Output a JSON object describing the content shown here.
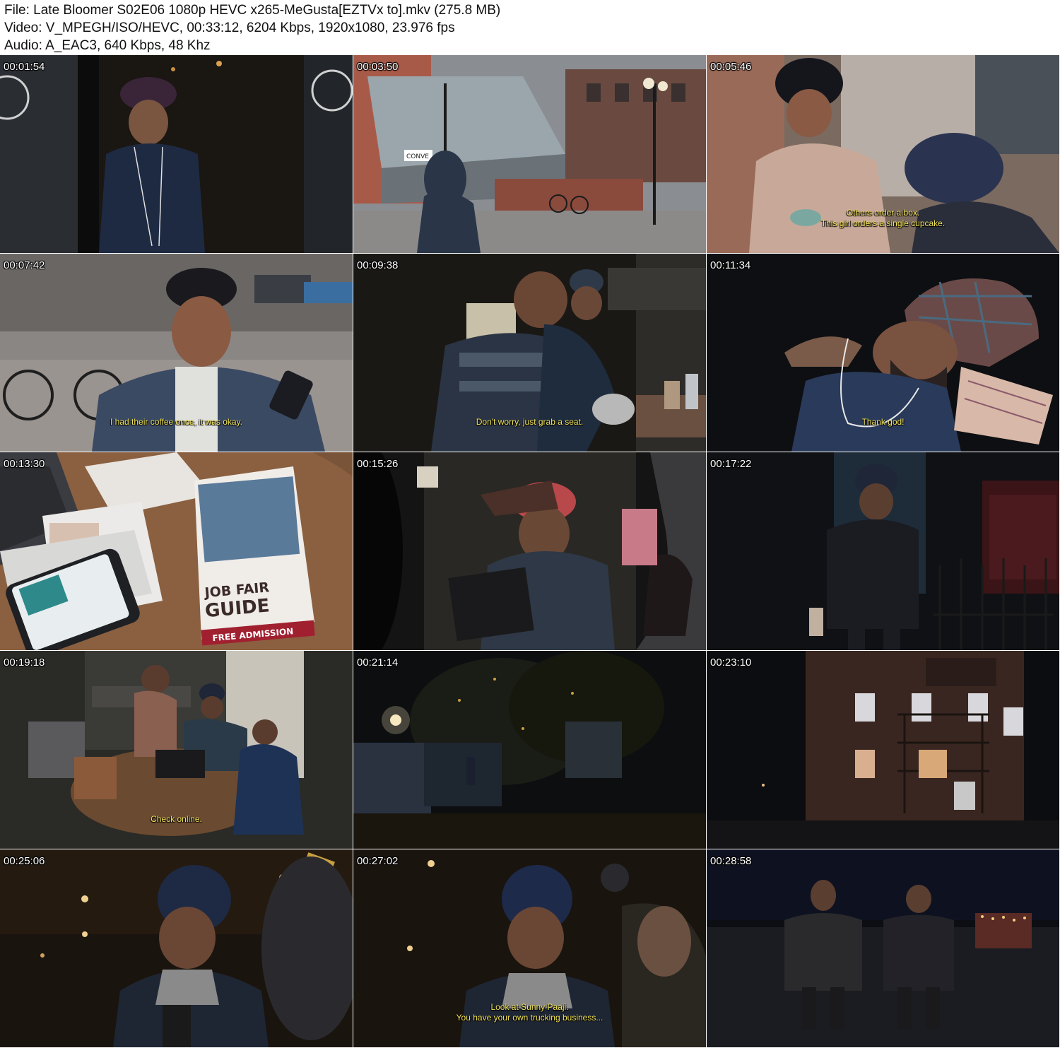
{
  "header": {
    "file_line": "File: Late Bloomer S02E06 1080p HEVC x265-MeGusta[EZTVx to].mkv (275.8 MB)",
    "video_line": "Video: V_MPEGH/ISO/HEVC, 00:33:12, 6204 Kbps, 1920x1080, 23.976 fps",
    "audio_line": "Audio: A_EAC3, 640 Kbps, 48 Khz"
  },
  "frames": [
    {
      "time": "00:01:54",
      "subtitle": []
    },
    {
      "time": "00:03:50",
      "subtitle": [],
      "sign_text": "CONVE"
    },
    {
      "time": "00:05:46",
      "subtitle": [
        "Others order a box.",
        "This girl orders a single cupcake."
      ]
    },
    {
      "time": "00:07:42",
      "subtitle": [
        "I had their coffee once, it was okay."
      ]
    },
    {
      "time": "00:09:38",
      "subtitle": [
        "Don't worry, just grab a seat."
      ]
    },
    {
      "time": "00:11:34",
      "subtitle": [
        "Thank god!"
      ]
    },
    {
      "time": "00:13:30",
      "subtitle": [],
      "flyer": {
        "line1": "JOB FAIR",
        "line2": "GUIDE",
        "line3": "FREE ADMISSION"
      }
    },
    {
      "time": "00:15:26",
      "subtitle": []
    },
    {
      "time": "00:17:22",
      "subtitle": []
    },
    {
      "time": "00:19:18",
      "subtitle": [
        "Check online."
      ]
    },
    {
      "time": "00:21:14",
      "subtitle": []
    },
    {
      "time": "00:23:10",
      "subtitle": []
    },
    {
      "time": "00:25:06",
      "subtitle": []
    },
    {
      "time": "00:27:02",
      "subtitle": [
        "Look at Sunny Paaji.",
        "You have your own trucking business..."
      ]
    },
    {
      "time": "00:28:58",
      "subtitle": []
    }
  ]
}
